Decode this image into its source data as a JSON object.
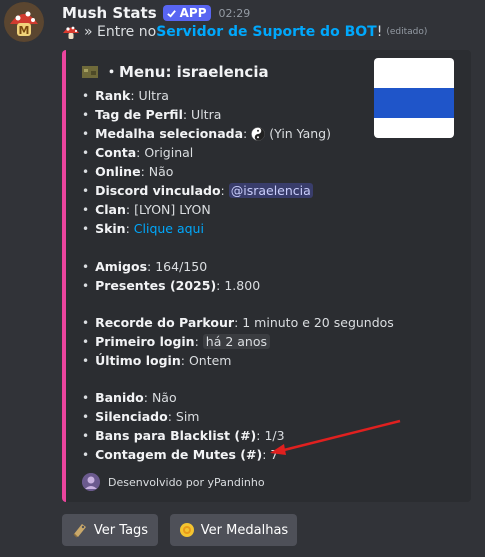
{
  "message": {
    "username": "Mush Stats",
    "badge": "APP",
    "timestamp": "02:29",
    "prefix": "» Entre no ",
    "link_text": "Servidor de Suporte do BOT",
    "suffix": "!",
    "edited": "(editado)"
  },
  "embed": {
    "title": "・Menu: israelencia",
    "accent_color": "#eb459e",
    "fields": [
      {
        "key": "Rank",
        "value": "Ultra"
      },
      {
        "key": "Tag de Perfil",
        "value": "Ultra"
      },
      {
        "key": "Medalha selecionada",
        "value": "(Yin Yang)"
      },
      {
        "key": "Conta",
        "value": "Original"
      },
      {
        "key": "Online",
        "value": "Não"
      },
      {
        "key": "Discord vinculado",
        "value": "@israelencia"
      },
      {
        "key": "Clan",
        "value": "[LYON] LYON"
      },
      {
        "key": "Skin",
        "value": "Clique aqui"
      },
      {
        "key": "Amigos",
        "value": "164/150"
      },
      {
        "key": "Presentes (2025)",
        "value": "1.800"
      },
      {
        "key": "Recorde do Parkour",
        "value": "1 minuto e 20 segundos"
      },
      {
        "key": "Primeiro login",
        "value": "há 2 anos"
      },
      {
        "key": "Último login",
        "value": "Ontem"
      },
      {
        "key": "Banido",
        "value": "Não"
      },
      {
        "key": "Silenciado",
        "value": "Sim"
      },
      {
        "key": "Bans para Blacklist (#)",
        "value": "1/3"
      },
      {
        "key": "Contagem de Mutes (#)",
        "value": "7"
      }
    ],
    "footer": "Desenvolvido por yPandinho"
  },
  "buttons": {
    "tags": "Ver Tags",
    "medals": "Ver Medalhas"
  },
  "icons": {
    "badge": "checkmark-icon",
    "line": "mushroom-icon",
    "title": "skin-icon",
    "medal": "yin-yang-icon",
    "tags_button": "tag-icon",
    "medals_button": "medal-icon",
    "annotation": "red-arrow-icon"
  }
}
